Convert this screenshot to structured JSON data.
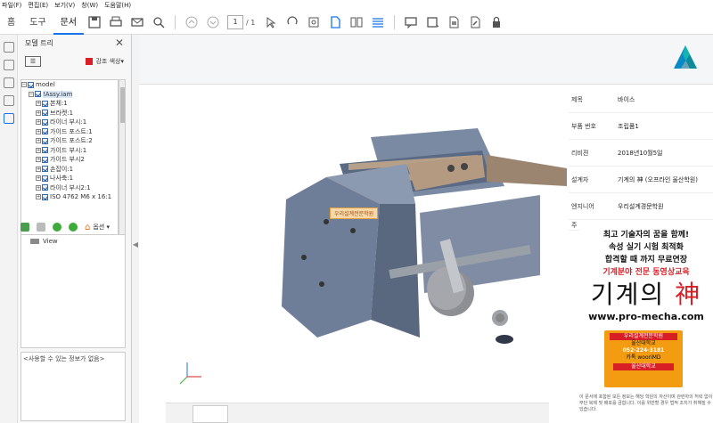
{
  "menu": [
    "파일(F)",
    "편집(E)",
    "보기(V)",
    "창(W)",
    "도움말(H)"
  ],
  "toolbar": {
    "tabs": [
      "홈",
      "도구",
      "문서"
    ],
    "active_tab": "문서",
    "page_current": "1",
    "page_total": "/ 1"
  },
  "panel": {
    "title": "모델 트리",
    "accent_label": "강조 색상",
    "accent_color": "#d81f26",
    "tree": [
      {
        "label": "model",
        "level": 0
      },
      {
        "label": "!Assy.iam",
        "level": 1
      },
      {
        "label": "본체:1",
        "level": 2
      },
      {
        "label": "브라켓:1",
        "level": 2
      },
      {
        "label": "라이너 부시:1",
        "level": 2
      },
      {
        "label": "가이드 포스트:1",
        "level": 2
      },
      {
        "label": "가이드 포스트:2",
        "level": 2
      },
      {
        "label": "가이드 부시:1",
        "level": 2
      },
      {
        "label": "가이드 부시2",
        "level": 2
      },
      {
        "label": "손잡이:1",
        "level": 2
      },
      {
        "label": "나사축:1",
        "level": 2
      },
      {
        "label": "라이너 부시2:1",
        "level": 2
      },
      {
        "label": "ISO 4762 M6 x 16:1",
        "level": 2
      }
    ],
    "options_label": "옵션",
    "view_item": "View",
    "info_text": "<사용할 수 있는 정보가 없음>"
  },
  "title_block": [
    {
      "key": "제목",
      "value": "바이스"
    },
    {
      "key": "부품 번호",
      "value": "조립품1"
    },
    {
      "key": "리비젼",
      "value": "2018년10월5일"
    },
    {
      "key": "설계자",
      "value": "기계의 神 (오프라인 울산학원)"
    },
    {
      "key": "엔지니어",
      "value": "우리설계경문학원"
    },
    {
      "key": "주",
      "value": ""
    }
  ],
  "model_label": "우리설계전문학원",
  "ad": {
    "line1": "최고 기술자의 꿈을 함께!",
    "line2": "속성 실기 시험 최적화",
    "line3": "합격할 때 까지 무료연장",
    "line4": "기계분야 전문 동영상교육",
    "brand": "기계의 ",
    "brand_accent": "神",
    "url": "www.pro-mecha.com",
    "card_line1": "우리설계전문학원",
    "card_line2": "울산대학교 ",
    "card_phone": "052-224-3181",
    "card_line3": "카톡 wooriMD",
    "card_line4": "울산대학교"
  },
  "footnote": "이 문서에 포함된 모든 정보는 해당 학원의 자산이며 관련자의 허락 없이 무단 복제 및 배포를 금합니다. 이를 위반할 경우 법적 조치가 취해질 수 있습니다."
}
